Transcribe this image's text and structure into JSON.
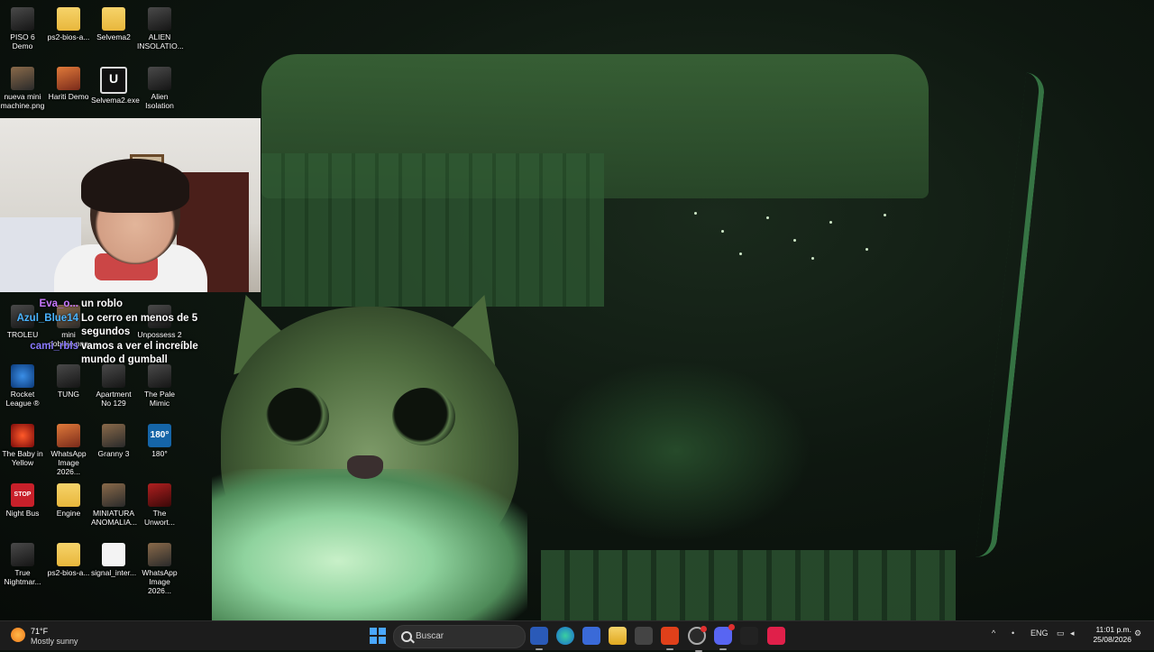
{
  "desktop": {
    "icons": [
      {
        "label": "PISO 6 Demo"
      },
      {
        "label": "ps2-bios-a..."
      },
      {
        "label": "Selvema2"
      },
      {
        "label": "ALIEN INSOLATIO..."
      },
      {
        "label": "nueva mini machine.png"
      },
      {
        "label": "Hariti Demo"
      },
      {
        "label": "Selvema2.exe"
      },
      {
        "label": "Alien Isolation"
      },
      {
        "label": "TROLEU"
      },
      {
        "label": "mini doblaje.png"
      },
      {
        "label": "Unpossess 2"
      },
      {
        "label": "Rocket League ®"
      },
      {
        "label": "TUNG"
      },
      {
        "label": "Apartment No 129"
      },
      {
        "label": "The Pale Mimic"
      },
      {
        "label": "The Baby in Yellow"
      },
      {
        "label": "WhatsApp Image 2026..."
      },
      {
        "label": "Granny 3"
      },
      {
        "label": "180°"
      },
      {
        "label": "Night Bus"
      },
      {
        "label": "Engine"
      },
      {
        "label": "MINIATURA ANOMALIA..."
      },
      {
        "label": "The Unwort..."
      },
      {
        "label": "True Nightmar..."
      },
      {
        "label": "ps2-bios-a..."
      },
      {
        "label": "signal_inter..."
      },
      {
        "label": "WhatsApp Image 2026..."
      }
    ],
    "icon_glyphs": {
      "ue": "U",
      "stop": "STOP",
      "deg": "180°"
    }
  },
  "chat": [
    {
      "user": "Eva_o...",
      "color": "#c878ff",
      "text": "un roblo"
    },
    {
      "user": "Azul_Blue14",
      "color": "#4ab4ff",
      "text": "Lo cerro en menos de 5 segundos"
    },
    {
      "user": "cami_rbls",
      "color": "#8a7aff",
      "text": "vamos a ver el increíble mundo d gumball"
    }
  ],
  "taskbar": {
    "weather": {
      "temp": "71°F",
      "condition": "Mostly sunny"
    },
    "search_placeholder": "Buscar",
    "apps": [
      "store-app",
      "edge",
      "microsoft-store",
      "file-explorer",
      "unity",
      "brave",
      "chrome-like",
      "discord",
      "steam-like",
      "tiktok"
    ],
    "tray": {
      "language": "ENG"
    },
    "clock": {
      "time": "11:01 p.m.",
      "date": "25/08/2026"
    }
  }
}
